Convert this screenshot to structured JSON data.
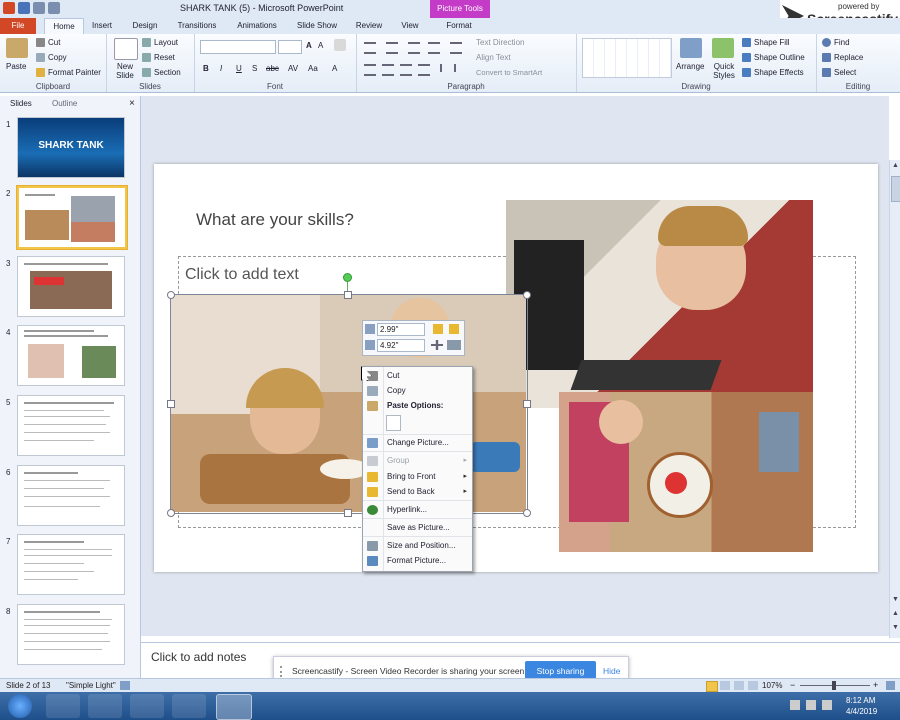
{
  "window": {
    "title": "SHARK TANK (5)  -  Microsoft PowerPoint",
    "context_tab": "Picture Tools"
  },
  "tabs": [
    "File",
    "Home",
    "Insert",
    "Design",
    "Transitions",
    "Animations",
    "Slide Show",
    "Review",
    "View",
    "Format"
  ],
  "watermark": {
    "powered_by": "powered by",
    "brand": "Screencastify"
  },
  "ribbon": {
    "clipboard": {
      "label": "Clipboard",
      "paste": "Paste",
      "cut": "Cut",
      "copy": "Copy",
      "format_painter": "Format Painter"
    },
    "slides": {
      "label": "Slides",
      "new_slide": "New Slide",
      "layout": "Layout",
      "reset": "Reset",
      "section": "Section"
    },
    "font": {
      "label": "Font",
      "bold": "B",
      "italic": "I",
      "underline": "U",
      "strike": "S",
      "abc": "abc",
      "av": "AV",
      "aa": "Aa",
      "color_a": "A"
    },
    "paragraph": {
      "label": "Paragraph",
      "text_direction": "Text Direction",
      "align_text": "Align Text",
      "convert_smartart": "Convert to SmartArt"
    },
    "drawing": {
      "label": "Drawing",
      "arrange": "Arrange",
      "quick_styles": "Quick Styles",
      "shape_fill": "Shape Fill",
      "shape_outline": "Shape Outline",
      "shape_effects": "Shape Effects"
    },
    "editing": {
      "label": "Editing",
      "find": "Find",
      "replace": "Replace",
      "select": "Select"
    }
  },
  "pane": {
    "tab_slides": "Slides",
    "tab_outline": "Outline",
    "close": "×",
    "thumb1_title": "SHARK TANK",
    "slide_numbers": [
      "1",
      "2",
      "3",
      "4",
      "5",
      "6",
      "7",
      "8"
    ]
  },
  "slide": {
    "title": "What are your skills?",
    "placeholder": "Click to add text"
  },
  "mini_toolbar": {
    "height": "2.99\"",
    "width": "4.92\""
  },
  "context_menu": {
    "cut": "Cut",
    "copy": "Copy",
    "paste_options": "Paste Options:",
    "change_picture": "Change Picture...",
    "group": "Group",
    "bring_front": "Bring to Front",
    "send_back": "Send to Back",
    "hyperlink": "Hyperlink...",
    "save_as_picture": "Save as Picture...",
    "size_position": "Size and Position...",
    "format_picture": "Format Picture..."
  },
  "notes": {
    "placeholder": "Click to add notes"
  },
  "share_bar": {
    "message": "Screencastify - Screen Video Recorder is sharing your screen.",
    "stop": "Stop sharing",
    "hide": "Hide"
  },
  "status": {
    "slide_of": "Slide 2 of 13",
    "theme": "\"Simple Light\"",
    "zoom": "107%"
  },
  "taskbar": {
    "time": "8:12 AM",
    "date": "4/4/2019"
  },
  "colors": {
    "file_tab": "#d24726",
    "context_tab": "#c43bc7",
    "share_button": "#3a86e0",
    "taskbar": "#1f4f8a"
  }
}
